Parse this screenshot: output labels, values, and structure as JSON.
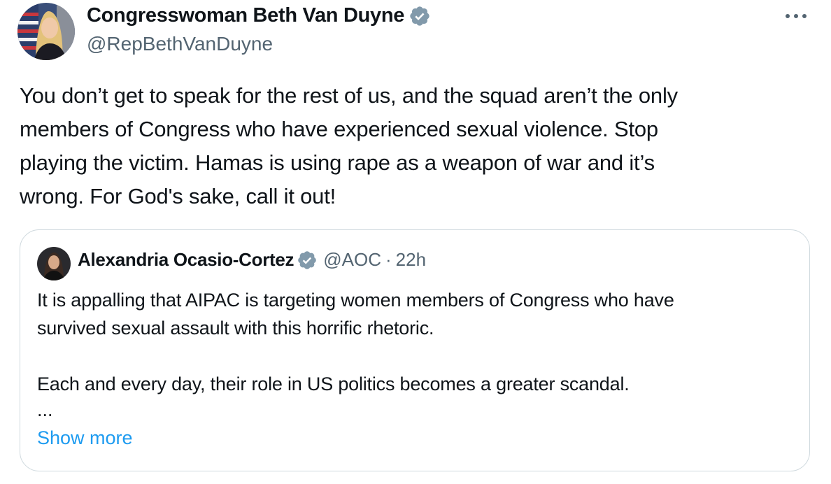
{
  "tweet": {
    "author_name": "Congresswoman Beth Van Duyne",
    "author_handle": "@RepBethVanDuyne",
    "text": "You don’t get to speak for the rest of us, and the squad aren’t the only\nmembers of Congress who have experienced sexual violence. Stop\nplaying the victim. Hamas is using rape as a weapon of war and it’s\nwrong. For God's sake, call it out!",
    "more_icon": "more-horizontal-icon"
  },
  "quote": {
    "author_name": "Alexandria Ocasio-Cortez",
    "author_handle": "@AOC",
    "separator": "·",
    "time": "22h",
    "text": "It is appalling that AIPAC is targeting women members of Congress who have\nsurvived sexual assault with this horrific rhetoric.\n\nEach and every day, their role in US politics becomes a greater scandal.",
    "ellipsis": "...",
    "show_more": "Show more"
  },
  "colors": {
    "verified_badge": "#829aab",
    "link": "#1d9bf0",
    "secondary_text": "#536471",
    "border": "#cfd9de"
  }
}
